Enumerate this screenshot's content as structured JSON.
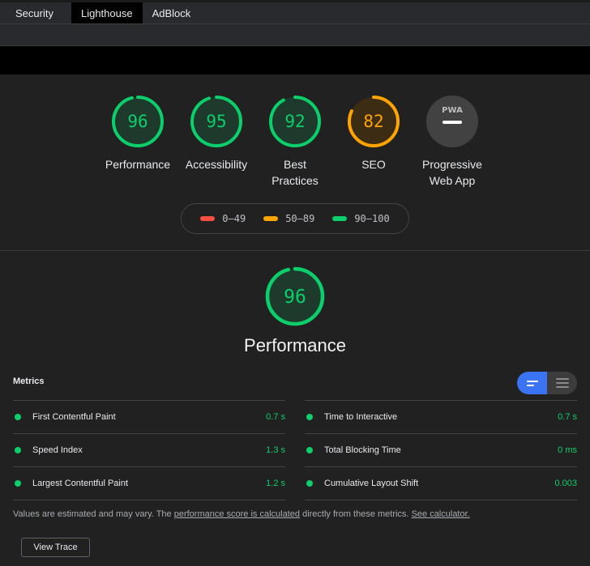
{
  "tabs": [
    {
      "label": "Security",
      "active": false
    },
    {
      "label": "Lighthouse",
      "active": true
    },
    {
      "label": "AdBlock",
      "active": false
    }
  ],
  "categories": [
    {
      "label_line1": "Performance",
      "label_line2": "",
      "score": "96",
      "fraction": 0.96,
      "color": "#0cce6b"
    },
    {
      "label_line1": "Accessibility",
      "label_line2": "",
      "score": "95",
      "fraction": 0.95,
      "color": "#0cce6b"
    },
    {
      "label_line1": "Best",
      "label_line2": "Practices",
      "score": "92",
      "fraction": 0.92,
      "color": "#0cce6b"
    },
    {
      "label_line1": "SEO",
      "label_line2": "",
      "score": "82",
      "fraction": 0.82,
      "color": "#ffa400"
    },
    {
      "label_line1": "Progressive",
      "label_line2": "Web App",
      "score": "PWA",
      "fraction": 0,
      "color": "#9aa0a6"
    }
  ],
  "legend": [
    {
      "range": "0–49",
      "color": "#ff4e42"
    },
    {
      "range": "50–89",
      "color": "#ffa400"
    },
    {
      "range": "90–100",
      "color": "#0cce6b"
    }
  ],
  "performance": {
    "score": "96",
    "fraction": 0.96,
    "title": "Performance"
  },
  "metrics": {
    "heading": "Metrics",
    "left": [
      {
        "name": "First Contentful Paint",
        "value": "0.7 s"
      },
      {
        "name": "Speed Index",
        "value": "1.3 s"
      },
      {
        "name": "Largest Contentful Paint",
        "value": "1.2 s"
      }
    ],
    "right": [
      {
        "name": "Time to Interactive",
        "value": "0.7 s"
      },
      {
        "name": "Total Blocking Time",
        "value": "0 ms"
      },
      {
        "name": "Cumulative Layout Shift",
        "value": "0.003"
      }
    ]
  },
  "note": {
    "prefix": "Values are estimated and may vary. The ",
    "link1": "performance score is calculated",
    "middle": " directly from these metrics. ",
    "link2": "See calculator."
  },
  "view_trace_label": "View Trace",
  "colors": {
    "pass": "#0cce6b",
    "average": "#ffa400",
    "fail": "#ff4e42",
    "accent": "#3a74f2"
  }
}
